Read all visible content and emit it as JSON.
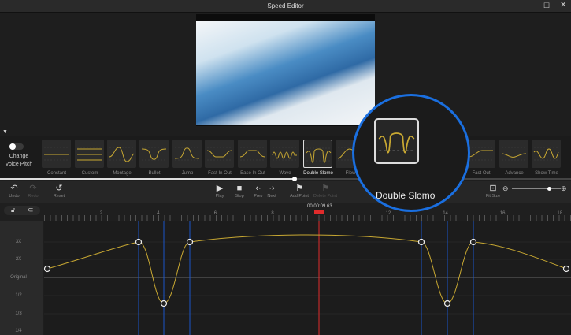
{
  "window": {
    "title": "Speed Editor",
    "maximize_icon": "maximize-icon",
    "close_icon": "close-icon"
  },
  "voice_pitch": {
    "label": "Change Voice Pitch",
    "enabled": false
  },
  "presets": [
    {
      "label": "Constant",
      "icon": "constant"
    },
    {
      "label": "Custom",
      "icon": "custom"
    },
    {
      "label": "Montage",
      "icon": "montage"
    },
    {
      "label": "Bullet",
      "icon": "bullet"
    },
    {
      "label": "Jump",
      "icon": "jump"
    },
    {
      "label": "Fast In Out",
      "icon": "fastinout"
    },
    {
      "label": "Ease In Out",
      "icon": "easeinout"
    },
    {
      "label": "Wave",
      "icon": "wave"
    },
    {
      "label": "Double Slomo",
      "icon": "doubleslomo",
      "selected": true
    },
    {
      "label": "Flow",
      "icon": "flow"
    },
    {
      "label": "Fast Out",
      "icon": "fastout"
    },
    {
      "label": "Advance",
      "icon": "advance"
    },
    {
      "label": "Show Time",
      "icon": "showtime"
    }
  ],
  "magnifier": {
    "label": "Double Slomo"
  },
  "toolbar": {
    "undo": "Undo",
    "redo": "Redo",
    "reset": "Reset",
    "play": "Play",
    "stop": "Stop",
    "prev": "Prev",
    "next": "Next",
    "add_point": "Add Point",
    "delete_point": "Delete Point",
    "fit_size": "Fit Size",
    "zoom_level": 0.75
  },
  "timeline": {
    "timestamp": "00:00:09.63",
    "ruler_labels": [
      "2",
      "4",
      "6",
      "8",
      "10",
      "12",
      "14",
      "16",
      "18"
    ]
  },
  "speed_axis": [
    "3X",
    "2X",
    "Original",
    "1/2",
    "1/3",
    "1/4"
  ],
  "colors": {
    "accent": "#1a6fe0",
    "curve": "#c8a832",
    "playhead": "#e02b2b"
  }
}
